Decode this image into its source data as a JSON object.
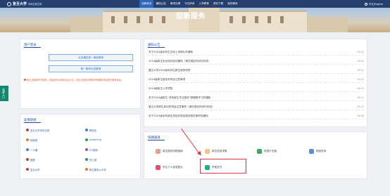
{
  "header": {
    "logo_name": "复旦大学",
    "logo_sub": "本科生新生网",
    "lang": "中文|English",
    "banner_title": "迎新服务",
    "nav": [
      {
        "label": "迎新首页",
        "active": true
      },
      {
        "label": "通知公告",
        "active": false
      },
      {
        "label": "事项办理",
        "active": false
      },
      {
        "label": "今日风采",
        "active": false
      },
      {
        "label": "入学教育",
        "active": false
      },
      {
        "label": "资料下载",
        "active": false
      },
      {
        "label": "我的事务",
        "active": false
      }
    ]
  },
  "side_tab": {
    "label": "快捷入口"
  },
  "login": {
    "title": "用户登录",
    "btn_primary": "点击通过统一身份登录",
    "btn_secondary": "统一身份认证登录",
    "tip": "新生请使用学号登录，初始密码为身份证后六位，如忘记密码请联系学院辅导员或拨打服务电话。"
  },
  "notices": {
    "title": "通知公告",
    "items": [
      {
        "text": "关于2024级本科生在线上传照片的通知",
        "date": "08-02"
      },
      {
        "text": "2024级新生安全知识培训通知（请在规定时间内完成）",
        "date": "08-02"
      },
      {
        "text": "复旦大学2024级本科生新生报到须知",
        "date": "08-01"
      },
      {
        "text": "2024级新生接站安排及注意事项",
        "date": "08-02"
      },
      {
        "text": "2024级新生入学须知",
        "date": "08-05"
      },
      {
        "text": "关于2024级新生“本科新生学业规划”微课程学习的通知",
        "date": "08-12"
      },
      {
        "text": "复旦大学新生军训安排及注意事项（请在规定时间内完成）",
        "date": "08-22"
      },
      {
        "text": "关于2024级本科新生体检安排及报到相关事项的通知",
        "date": "08-06"
      }
    ]
  },
  "links": {
    "title": "友情链接",
    "items": [
      {
        "label": "复旦大学本科生院",
        "color": "#c23b3b"
      },
      {
        "label": "教务处",
        "color": "#3b7fd0"
      },
      {
        "label": "校医院",
        "color": "#e07a2e"
      },
      {
        "label": "eLearning",
        "color": "#2b9a5a"
      },
      {
        "label": "一卡通",
        "color": "#3b7fd0"
      },
      {
        "label": "ITC服务",
        "color": "#8a59c5"
      },
      {
        "label": "团委",
        "color": "#c23b3b"
      },
      {
        "label": "学工部",
        "color": "#2b9a5a"
      },
      {
        "label": "复旦大学",
        "color": "#c23b3b"
      },
      {
        "label": "新生服务公众号",
        "color": "#e07a2e"
      }
    ]
  },
  "quick": {
    "title": "快捷通道",
    "items": [
      {
        "label": "新生报到流程指南",
        "color": "#e8a08a"
      },
      {
        "label": "新生信息采集",
        "color": "#f1c38a"
      },
      {
        "label": "校园卡充值",
        "color": "#3aa86c"
      },
      {
        "label": "宿舍查询",
        "color": "#5b8fd8"
      },
      {
        "label": "学生个人信息登记",
        "color": "#e0506a"
      },
      {
        "label": "学费支付",
        "color": "#20b27c"
      }
    ]
  }
}
